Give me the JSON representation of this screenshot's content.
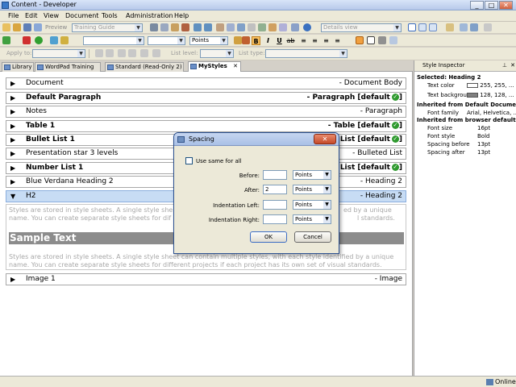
{
  "window": {
    "title": "Content - Developer"
  },
  "menu": [
    "File",
    "Edit",
    "View",
    "Document",
    "Tools",
    "Administration",
    "Help"
  ],
  "toolbar1": {
    "preview_label": "Preview",
    "project_combo": "Training Guide",
    "view_combo": "Details view"
  },
  "toolbar2": {
    "font_combo": "",
    "size_combo": "",
    "units_combo": "Points"
  },
  "toolbar3": {
    "apply_to_label": "Apply to:",
    "list_level_label": "List level:",
    "list_type_label": "List type:"
  },
  "tabs": [
    {
      "label": "Library"
    },
    {
      "label": "WordPad Training"
    },
    {
      "label": "Standard (Read-Only 2)"
    },
    {
      "label": "MyStyles"
    }
  ],
  "styles": [
    {
      "name": "Document",
      "type": "- Document Body",
      "bold": false,
      "check": false
    },
    {
      "name": "Default Paragraph",
      "type": "- Paragraph [default",
      "bold": true,
      "check": true
    },
    {
      "name": "Notes",
      "type": "- Paragraph",
      "bold": false,
      "check": false
    },
    {
      "name": "Table 1",
      "type": "- Table [default",
      "bold": true,
      "check": true
    },
    {
      "name": "Bullet List 1",
      "type": "List [default",
      "bold": true,
      "check": true
    },
    {
      "name": "Presentation star 3 levels",
      "type": "- Bulleted List",
      "bold": false,
      "check": false
    },
    {
      "name": "Number List 1",
      "type": "List [default",
      "bold": true,
      "check": true
    },
    {
      "name": "Blue Verdana Heading 2",
      "type": "- Heading 2",
      "bold": false,
      "check": false
    },
    {
      "name": "H2",
      "type": "- Heading 2",
      "bold": false,
      "check": false
    },
    {
      "name": "Image 1",
      "type": "- Image",
      "bold": false,
      "check": false
    }
  ],
  "preview": {
    "line1": "Styles are stored in style sheets. A single style she",
    "line1_tail": "ed by a unique",
    "line2": "name. You can create separate style sheets for dif",
    "line2_tail": "l standards.",
    "sample": "Sample Text",
    "line3": "Styles are stored in style sheets. A single style sheet can contain multiple styles, with each style identified by a unique",
    "line4": "name. You can create separate style sheets for different projects if each project has its own set of visual standards."
  },
  "inspector": {
    "title": "Style Inspector",
    "sections": [
      {
        "header": "Selected: Heading 2",
        "props": [
          {
            "key": "Text color",
            "value": "255, 255, ...",
            "swatch": "#ffffff"
          },
          {
            "key": "Text backgrour",
            "value": "128, 128, ...",
            "swatch": "#808080"
          }
        ]
      },
      {
        "header": "Inherited from Default Documen",
        "props": [
          {
            "key": "Font family",
            "value": "Arial, Helvetica, ..."
          }
        ]
      },
      {
        "header": "Inherited from browser defaults",
        "props": [
          {
            "key": "Font size",
            "value": "16pt"
          },
          {
            "key": "Font style",
            "value": "Bold"
          },
          {
            "key": "Spacing before",
            "value": "13pt"
          },
          {
            "key": "Spacing after",
            "value": "13pt"
          }
        ]
      }
    ]
  },
  "status": {
    "text": "Online"
  },
  "dialog": {
    "title": "Spacing",
    "use_same_label": "Use same for all",
    "before_label": "Before:",
    "before_value": "",
    "after_label": "After:",
    "after_value": "2",
    "ind_left_label": "Indentation Left:",
    "ind_left_value": "",
    "ind_right_label": "Indentation Right:",
    "ind_right_value": "",
    "unit": "Points",
    "ok": "OK",
    "cancel": "Cancel"
  },
  "colors": {
    "check": "#2f9a2f",
    "selected_row": "#c7dcf4",
    "sample_bg": "#8c8c8c"
  }
}
